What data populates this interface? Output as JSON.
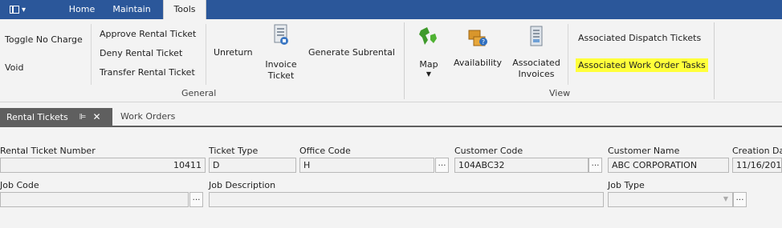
{
  "menu": {
    "tabs": [
      "Home",
      "Maintain",
      "Tools"
    ],
    "active": "Tools"
  },
  "ribbon": {
    "general": {
      "toggle_no_charge": "Toggle No Charge",
      "void": "Void",
      "approve": "Approve Rental Ticket",
      "deny": "Deny Rental Ticket",
      "transfer": "Transfer Rental Ticket",
      "unreturn": "Unreturn",
      "invoice_ticket_1": "Invoice",
      "invoice_ticket_2": "Ticket",
      "generate_subrental": "Generate Subrental",
      "label": "General"
    },
    "view": {
      "map": "Map",
      "availability": "Availability",
      "associated_invoices_1": "Associated",
      "associated_invoices_2": "Invoices",
      "dispatch_tickets": "Associated Dispatch Tickets",
      "work_order_tasks": "Associated Work Order Tasks",
      "label": "View"
    },
    "highlight_color": "#ffff3a"
  },
  "doc_tabs": {
    "active": "Rental Tickets",
    "other": "Work Orders"
  },
  "form": {
    "rental_ticket_number": {
      "label": "Rental Ticket Number",
      "value": "10411"
    },
    "ticket_type": {
      "label": "Ticket Type",
      "value": "D"
    },
    "office_code": {
      "label": "Office Code",
      "value": "H"
    },
    "customer_code": {
      "label": "Customer Code",
      "value": "104ABC32"
    },
    "customer_name": {
      "label": "Customer Name",
      "value": "ABC CORPORATION"
    },
    "creation_date": {
      "label": "Creation Da",
      "value": "11/16/201"
    },
    "job_code": {
      "label": "Job Code",
      "value": ""
    },
    "job_description": {
      "label": "Job Description",
      "value": ""
    },
    "job_type": {
      "label": "Job Type",
      "value": ""
    }
  },
  "colors": {
    "menubar": "#2b579a",
    "doc_tab_active": "#5f5f5f"
  }
}
